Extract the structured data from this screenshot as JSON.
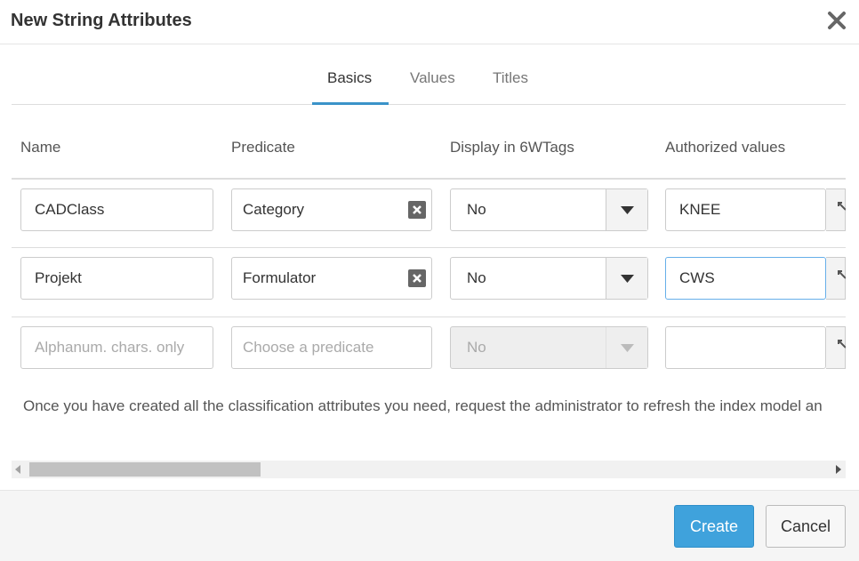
{
  "dialog": {
    "title": "New String Attributes"
  },
  "tabs": [
    {
      "label": "Basics",
      "active": true
    },
    {
      "label": "Values",
      "active": false
    },
    {
      "label": "Titles",
      "active": false
    }
  ],
  "columns": {
    "name": "Name",
    "predicate": "Predicate",
    "display": "Display in 6WTags",
    "authorized": "Authorized values"
  },
  "rows": [
    {
      "name": "CADClass",
      "predicate": "Category",
      "display": "No",
      "authorized": "KNEE"
    },
    {
      "name": "Projekt",
      "predicate": "Formulator",
      "display": "No",
      "authorized": "CWS"
    },
    {
      "name_placeholder": "Alphanum. chars. only",
      "predicate_placeholder": "Choose a predicate",
      "display": "No",
      "authorized": ""
    }
  ],
  "note": "Once you have created all the classification attributes you need, request the administrator to refresh the index model an",
  "footer": {
    "create_label": "Create",
    "cancel_label": "Cancel"
  },
  "colors": {
    "accent": "#3a93c9",
    "primary_button": "#3fa2dc",
    "focus_border": "#66afe9"
  },
  "icons": {
    "close": "close-icon",
    "clear": "clear-icon",
    "dropdown": "caret-down-icon",
    "pin": "pin-icon"
  }
}
